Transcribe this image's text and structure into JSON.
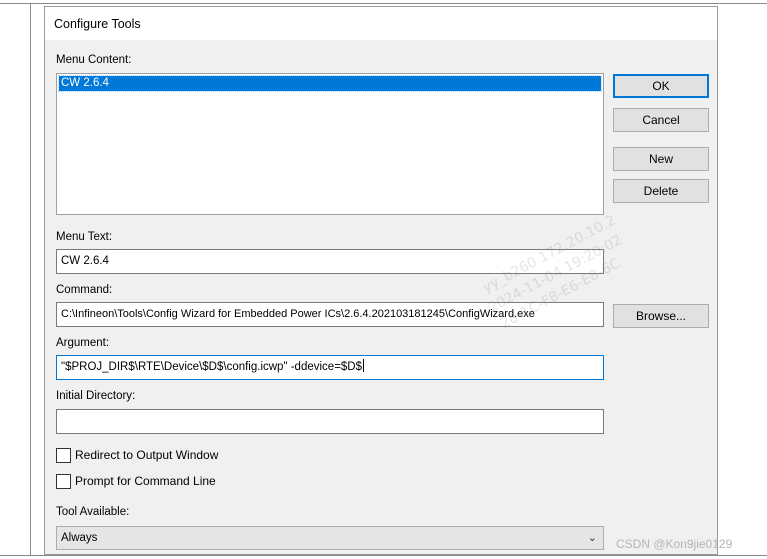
{
  "dialog": {
    "title": "Configure Tools"
  },
  "menu_content": {
    "label": "Menu Content:",
    "items": [
      "CW 2.6.4"
    ],
    "selected_index": 0
  },
  "menu_text": {
    "label": "Menu Text:",
    "value": "CW 2.6.4"
  },
  "command": {
    "label": "Command:",
    "value": "C:\\Infineon\\Tools\\Config Wizard for Embedded Power ICs\\2.6.4.202103181245\\ConfigWizard.exe"
  },
  "argument": {
    "label": "Argument:",
    "value": "\"$PROJ_DIR$\\RTE\\Device\\$D$\\config.icwp\" -ddevice=$D$"
  },
  "initial_directory": {
    "label": "Initial Directory:",
    "value": ""
  },
  "redirect_output": {
    "label": "Redirect to Output Window",
    "checked": false
  },
  "prompt_command": {
    "label": "Prompt for Command Line",
    "checked": false
  },
  "tool_available": {
    "label": "Tool Available:",
    "value": "Always"
  },
  "buttons": {
    "ok": "OK",
    "cancel": "Cancel",
    "new": "New",
    "delete": "Delete",
    "browse": "Browse..."
  },
  "watermark": {
    "line1": "yy_b260   172.20.10.2",
    "line2": "2024-11-04   19:20:02",
    "line3": "28-1C-F8-E6-E8-6C"
  },
  "credit": "CSDN @Kon9jie0129"
}
